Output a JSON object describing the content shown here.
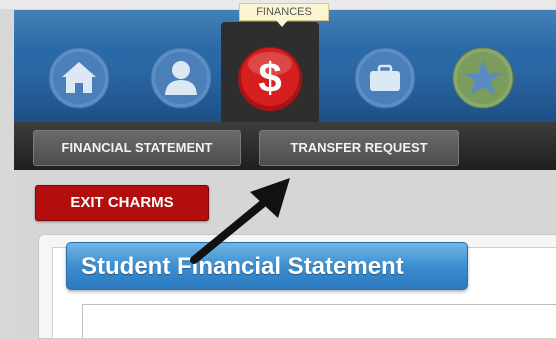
{
  "tooltip": {
    "text": "FINANCES"
  },
  "nav": {
    "items": [
      {
        "icon": "home-icon"
      },
      {
        "icon": "user-icon"
      },
      {
        "icon": "dollar-icon",
        "active": true
      },
      {
        "icon": "briefcase-icon"
      },
      {
        "icon": "star-icon"
      }
    ]
  },
  "subnav": {
    "financial_statement": "FINANCIAL STATEMENT",
    "transfer_request": "TRANSFER REQUEST"
  },
  "exit_button": "EXIT CHARMS",
  "main": {
    "title": "Student Financial Statement"
  },
  "colors": {
    "nav_blue": "#2a66a4",
    "exit_red": "#b30d0d",
    "title_blue": "#3d8fd0",
    "dollar_red": "#d61f1f"
  }
}
